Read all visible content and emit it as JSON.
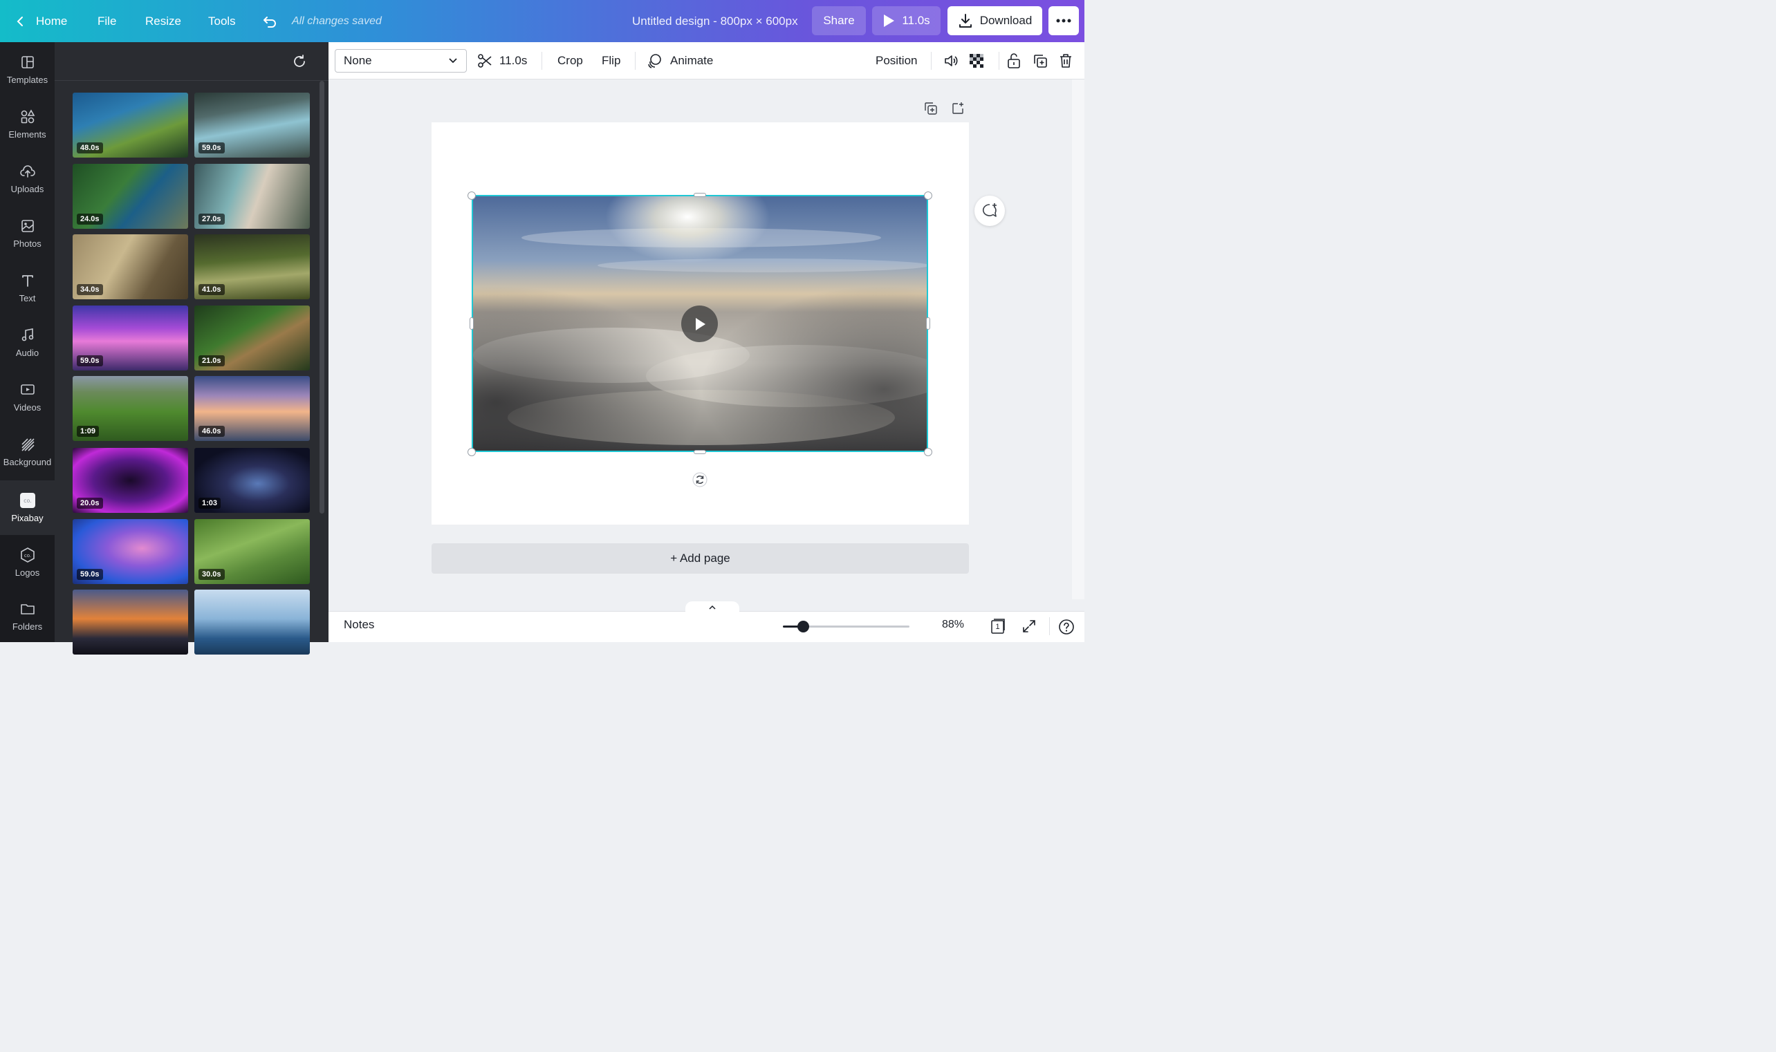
{
  "topbar": {
    "home": "Home",
    "file": "File",
    "resize": "Resize",
    "tools": "Tools",
    "saved_status": "All changes saved",
    "design_title": "Untitled design - 800px × 600px",
    "share": "Share",
    "play_duration": "11.0s",
    "download": "Download"
  },
  "rail": {
    "items": [
      {
        "label": "Templates",
        "icon": "templates-icon"
      },
      {
        "label": "Elements",
        "icon": "elements-icon"
      },
      {
        "label": "Uploads",
        "icon": "uploads-icon"
      },
      {
        "label": "Photos",
        "icon": "photos-icon"
      },
      {
        "label": "Text",
        "icon": "text-icon"
      },
      {
        "label": "Audio",
        "icon": "audio-icon"
      },
      {
        "label": "Videos",
        "icon": "videos-icon"
      },
      {
        "label": "Background",
        "icon": "background-icon"
      },
      {
        "label": "Pixabay",
        "icon": "pixabay-icon"
      },
      {
        "label": "Logos",
        "icon": "logos-icon"
      },
      {
        "label": "Folders",
        "icon": "folders-icon"
      }
    ]
  },
  "panel": {
    "videos": [
      {
        "duration": "48.0s"
      },
      {
        "duration": "59.0s"
      },
      {
        "duration": "24.0s"
      },
      {
        "duration": "27.0s"
      },
      {
        "duration": "34.0s"
      },
      {
        "duration": "41.0s"
      },
      {
        "duration": "59.0s"
      },
      {
        "duration": "21.0s"
      },
      {
        "duration": "1:09"
      },
      {
        "duration": "46.0s"
      },
      {
        "duration": "20.0s"
      },
      {
        "duration": "1:03"
      },
      {
        "duration": "59.0s"
      },
      {
        "duration": "30.0s"
      },
      {
        "duration": ""
      },
      {
        "duration": ""
      }
    ]
  },
  "toolbar": {
    "filter_value": "None",
    "trim_duration": "11.0s",
    "crop": "Crop",
    "flip": "Flip",
    "animate": "Animate",
    "position": "Position"
  },
  "canvas": {
    "add_page": "+ Add page"
  },
  "bottombar": {
    "notes": "Notes",
    "zoom": "88%",
    "zoom_fraction": 0.16,
    "page_count": "1"
  },
  "colors": {
    "accent_selection": "#1fc7d4",
    "topbar_start": "#14bcc9",
    "topbar_end": "#7b4fe0"
  }
}
